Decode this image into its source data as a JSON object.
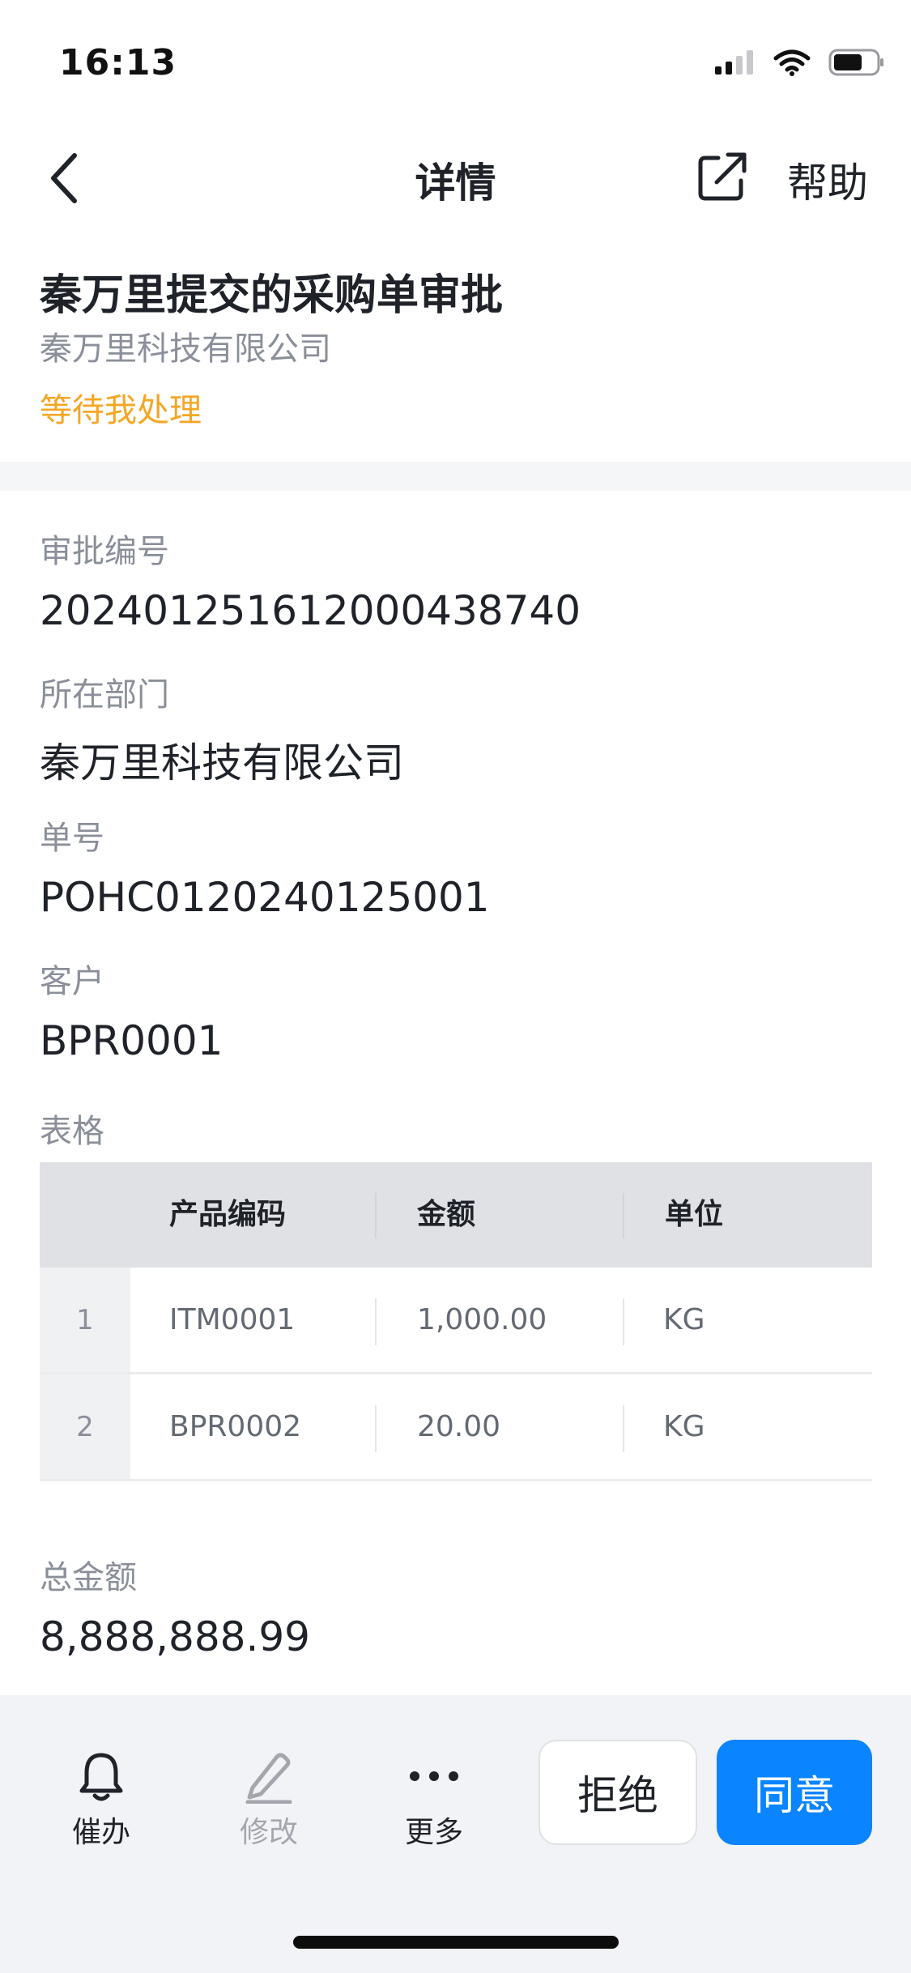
{
  "status_bar": {
    "time": "16:13"
  },
  "nav": {
    "title": "详情",
    "help_label": "帮助"
  },
  "header": {
    "title": "秦万里提交的采购单审批",
    "company": "秦万里科技有限公司",
    "status": "等待我处理"
  },
  "fields": [
    {
      "label": "审批编号",
      "value": "202401251612000438740"
    },
    {
      "label": "所在部门",
      "value": "秦万里科技有限公司"
    },
    {
      "label": "单号",
      "value": "POHC0120240125001"
    },
    {
      "label": "客户",
      "value": "BPR0001"
    }
  ],
  "table": {
    "label": "表格",
    "headers": [
      "产品编码",
      "金额",
      "单位"
    ],
    "rows": [
      {
        "index": "1",
        "code": "ITM0001",
        "amount": "1,000.00",
        "unit": "KG"
      },
      {
        "index": "2",
        "code": "BPR0002",
        "amount": "20.00",
        "unit": "KG"
      }
    ]
  },
  "total": {
    "label": "总金额",
    "value": "8,888,888.99"
  },
  "bottom_bar": {
    "urge_label": "催办",
    "edit_label": "修改",
    "more_label": "更多",
    "reject_label": "拒绝",
    "approve_label": "同意"
  },
  "colors": {
    "status_pending": "#f5a623",
    "primary": "#0a84ff",
    "secondary_text": "#8a8f99"
  },
  "icons": {
    "back": "chevron-left-icon",
    "share": "share-icon",
    "urge": "bell-icon",
    "edit": "pencil-icon",
    "more": "ellipsis-icon"
  }
}
